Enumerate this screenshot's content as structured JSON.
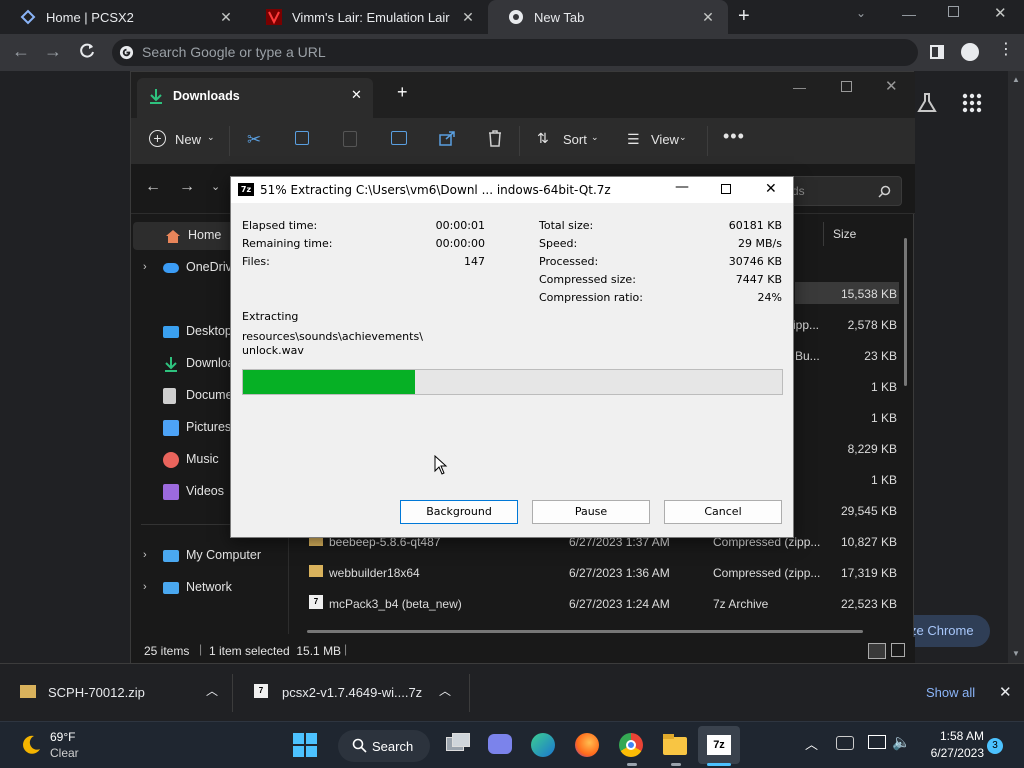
{
  "chrome": {
    "tabs": [
      {
        "title": "Home | PCSX2",
        "icon": "pcsx2-icon"
      },
      {
        "title": "Vimm's Lair: Emulation Lair",
        "icon": "vimm-icon"
      },
      {
        "title": "New Tab",
        "icon": "chrome-icon"
      }
    ],
    "omnibox_placeholder": "Search Google or type a URL",
    "customize_label": "ze Chrome"
  },
  "explorer": {
    "tab_title": "Downloads",
    "toolbar": {
      "new": "New",
      "sort": "Sort",
      "view": "View"
    },
    "search_placeholder": "ds",
    "column_size": "Size",
    "sidebar": [
      {
        "label": "Home",
        "icon": "home-icon",
        "color": "#e8855a"
      },
      {
        "label": "OneDrive",
        "icon": "cloud-icon",
        "color": "#3b9cf5"
      },
      {
        "label": "Desktop",
        "icon": "desktop-icon",
        "color": "#3aa0f0"
      },
      {
        "label": "Downloads",
        "icon": "download-icon",
        "color": "#2ec27e"
      },
      {
        "label": "Documents",
        "icon": "document-icon",
        "color": "#cfcfcf"
      },
      {
        "label": "Pictures",
        "icon": "picture-icon",
        "color": "#4da3f7"
      },
      {
        "label": "Music",
        "icon": "music-icon",
        "color": "#e9645c"
      },
      {
        "label": "Videos",
        "icon": "video-icon",
        "color": "#9c6ade"
      },
      {
        "label": "My Computer",
        "icon": "computer-icon",
        "color": "#4aa8f0"
      },
      {
        "label": "Network",
        "icon": "network-icon",
        "color": "#4aa8f0"
      }
    ],
    "partial_types": [
      "ipp...",
      "Bu..."
    ],
    "sizes": [
      "15,538 KB",
      "2,578 KB",
      "23 KB",
      "1 KB",
      "1 KB",
      "8,229 KB",
      "1 KB",
      "29,545 KB"
    ],
    "files": [
      {
        "name": "beebeep-5.8.6-qt487",
        "date": "6/27/2023 1:37 AM",
        "type": "Compressed (zipp...",
        "size": "10,827 KB"
      },
      {
        "name": "webbuilder18x64",
        "date": "6/27/2023 1:36 AM",
        "type": "Compressed (zipp...",
        "size": "17,319 KB"
      },
      {
        "name": "mcPack3_b4 (beta_new)",
        "date": "6/27/2023 1:24 AM",
        "type": "7z Archive",
        "size": "22,523 KB"
      }
    ],
    "status": {
      "items": "25 items",
      "selected": "1 item selected  15.1 MB"
    }
  },
  "sevenzip": {
    "title": "51% Extracting C:\\Users\\vm6\\Downl ... indows-64bit-Qt.7z",
    "left_stats": [
      {
        "label": "Elapsed time:",
        "value": "00:00:01"
      },
      {
        "label": "Remaining time:",
        "value": "00:00:00"
      },
      {
        "label": "Files:",
        "value": "147"
      }
    ],
    "right_stats": [
      {
        "label": "Total size:",
        "value": "60181 KB"
      },
      {
        "label": "Speed:",
        "value": "29 MB/s"
      },
      {
        "label": "Processed:",
        "value": "30746 KB"
      },
      {
        "label": "Compressed size:",
        "value": "7447 KB"
      },
      {
        "label": "Compression ratio:",
        "value": "24%"
      }
    ],
    "operation": "Extracting",
    "current_path_line1": "resources\\sounds\\achievements\\",
    "current_path_line2": "unlock.wav",
    "progress": 0.32,
    "buttons": {
      "background": "Background",
      "pause": "Pause",
      "cancel": "Cancel"
    }
  },
  "download_bar": {
    "items": [
      "SCPH-70012.zip",
      "pcsx2-v1.7.4649-wi....7z"
    ],
    "show_all": "Show all"
  },
  "taskbar": {
    "weather_temp": "69°F",
    "weather_desc": "Clear",
    "search": "Search",
    "time": "1:58 AM",
    "date": "6/27/2023",
    "notifications": "3"
  }
}
